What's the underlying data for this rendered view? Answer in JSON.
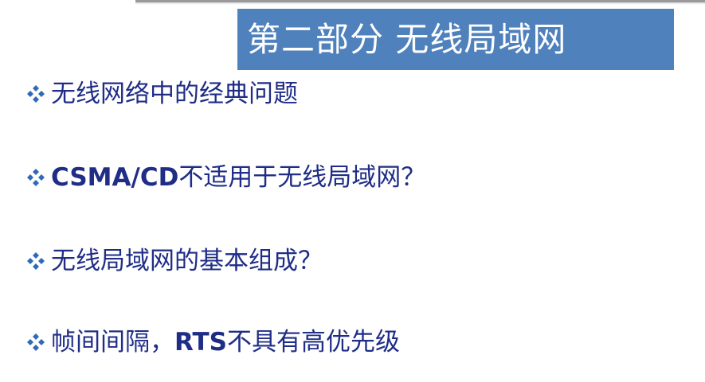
{
  "slide": {
    "title": "第二部分 无线局域网",
    "colors": {
      "title_bg": "#4f81bd",
      "title_text": "#ffffff",
      "bullet_text": "#1f2d86",
      "bullet_icon": "#2f6ab8"
    },
    "bullet_icon": "diamond-cluster-icon",
    "bullets": [
      {
        "prefix": "",
        "text": "无线网络中的经典问题"
      },
      {
        "prefix": "CSMA/CD",
        "text": "不适用于无线局域网？"
      },
      {
        "prefix": "",
        "text": "无线局域网的基本组成？"
      },
      {
        "prefix_cn": "帧间间隔，",
        "prefix": "RTS",
        "text": "不具有高优先级"
      }
    ]
  }
}
